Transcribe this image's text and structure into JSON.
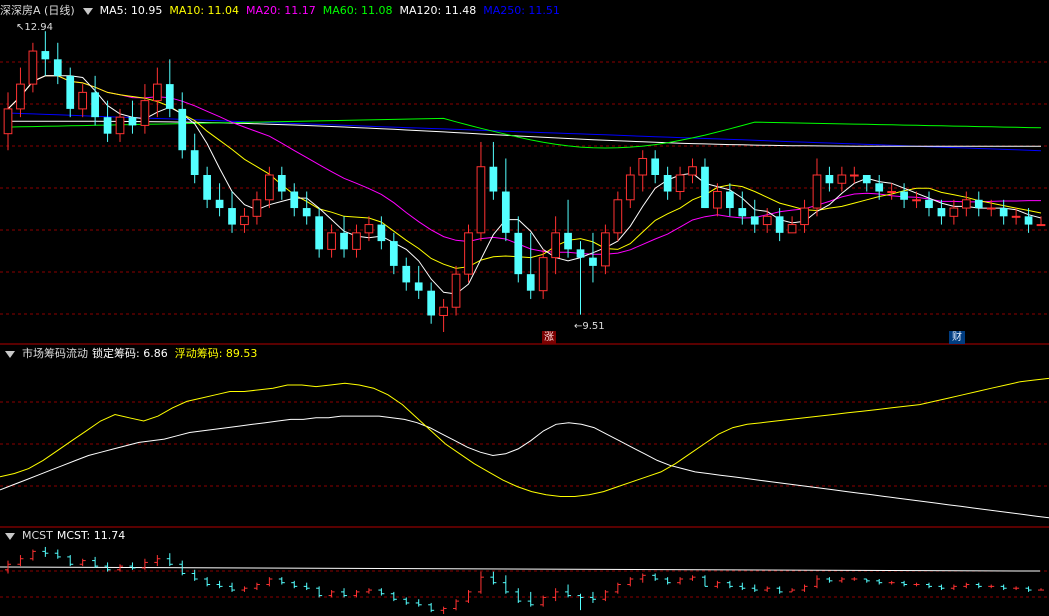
{
  "main_panel": {
    "title": "深深房A (日线)",
    "indicators": [
      {
        "label": "MA5: 10.95",
        "color": "#ffffff"
      },
      {
        "label": "MA10: 11.04",
        "color": "#ffff00"
      },
      {
        "label": "MA20: 11.17",
        "color": "#ff00ff"
      },
      {
        "label": "MA60: 11.08",
        "color": "#00ff00"
      },
      {
        "label": "MA120: 11.48",
        "color": "#ffffff"
      },
      {
        "label": "MA250: 11.51",
        "color": "#0000ff"
      }
    ],
    "high_label": "12.94",
    "low_label": "9.51",
    "marker_zhang": "涨",
    "marker_cai": "财"
  },
  "chip_panel": {
    "title": "市场筹码流动",
    "locked": "锁定筹码: 6.86",
    "floating_prefix": "浮动筹码",
    "floating_value": ": 89.53"
  },
  "mcst_panel": {
    "title": "MCST",
    "value": "MCST: 11.74"
  },
  "colors": {
    "up": "#ff3232",
    "down": "#54ffff",
    "grid": "#8b0000",
    "divider": "#b40000"
  },
  "chart_data": {
    "type": "candlestick",
    "price_range": [
      9.51,
      12.94
    ],
    "ohlc": [
      [
        11.7,
        12.2,
        11.5,
        12.0
      ],
      [
        12.0,
        12.5,
        11.9,
        12.3
      ],
      [
        12.3,
        12.8,
        12.2,
        12.7
      ],
      [
        12.7,
        12.94,
        12.4,
        12.6
      ],
      [
        12.6,
        12.8,
        12.3,
        12.4
      ],
      [
        12.4,
        12.5,
        11.9,
        12.0
      ],
      [
        12.0,
        12.3,
        11.9,
        12.2
      ],
      [
        12.2,
        12.4,
        11.8,
        11.9
      ],
      [
        11.9,
        12.1,
        11.6,
        11.7
      ],
      [
        11.7,
        12.0,
        11.6,
        11.9
      ],
      [
        11.9,
        12.1,
        11.7,
        11.8
      ],
      [
        11.8,
        12.3,
        11.7,
        12.1
      ],
      [
        12.1,
        12.5,
        11.9,
        12.3
      ],
      [
        12.3,
        12.6,
        11.9,
        12.0
      ],
      [
        12.0,
        12.2,
        11.4,
        11.5
      ],
      [
        11.5,
        11.7,
        11.1,
        11.2
      ],
      [
        11.2,
        11.3,
        10.8,
        10.9
      ],
      [
        10.9,
        11.1,
        10.7,
        10.8
      ],
      [
        10.8,
        11.0,
        10.5,
        10.6
      ],
      [
        10.6,
        10.8,
        10.5,
        10.7
      ],
      [
        10.7,
        11.0,
        10.6,
        10.9
      ],
      [
        10.9,
        11.3,
        10.8,
        11.2
      ],
      [
        11.2,
        11.3,
        10.9,
        11.0
      ],
      [
        11.0,
        11.1,
        10.7,
        10.8
      ],
      [
        10.8,
        11.0,
        10.6,
        10.7
      ],
      [
        10.7,
        10.8,
        10.2,
        10.3
      ],
      [
        10.3,
        10.6,
        10.2,
        10.5
      ],
      [
        10.5,
        10.7,
        10.2,
        10.3
      ],
      [
        10.3,
        10.6,
        10.2,
        10.5
      ],
      [
        10.5,
        10.7,
        10.4,
        10.6
      ],
      [
        10.6,
        10.7,
        10.3,
        10.4
      ],
      [
        10.4,
        10.5,
        10.0,
        10.1
      ],
      [
        10.1,
        10.2,
        9.8,
        9.9
      ],
      [
        9.9,
        10.1,
        9.7,
        9.8
      ],
      [
        9.8,
        9.9,
        9.4,
        9.5
      ],
      [
        9.5,
        9.7,
        9.3,
        9.6
      ],
      [
        9.6,
        10.1,
        9.5,
        10.0
      ],
      [
        10.0,
        10.6,
        9.9,
        10.5
      ],
      [
        10.5,
        11.6,
        10.4,
        11.3
      ],
      [
        11.3,
        11.6,
        10.9,
        11.0
      ],
      [
        11.0,
        11.4,
        10.4,
        10.5
      ],
      [
        10.5,
        10.7,
        9.9,
        10.0
      ],
      [
        10.0,
        10.5,
        9.7,
        9.8
      ],
      [
        9.8,
        10.3,
        9.7,
        10.2
      ],
      [
        10.2,
        10.7,
        10.0,
        10.5
      ],
      [
        10.5,
        10.9,
        10.2,
        10.3
      ],
      [
        10.3,
        10.4,
        9.51,
        10.2
      ],
      [
        10.2,
        10.5,
        9.9,
        10.1
      ],
      [
        10.1,
        10.6,
        10.0,
        10.5
      ],
      [
        10.5,
        11.0,
        10.4,
        10.9
      ],
      [
        10.9,
        11.3,
        10.8,
        11.2
      ],
      [
        11.2,
        11.5,
        11.0,
        11.4
      ],
      [
        11.4,
        11.5,
        11.1,
        11.2
      ],
      [
        11.2,
        11.3,
        10.9,
        11.0
      ],
      [
        11.0,
        11.3,
        10.9,
        11.2
      ],
      [
        11.2,
        11.4,
        11.1,
        11.3
      ],
      [
        11.3,
        11.4,
        10.8,
        10.8
      ],
      [
        10.8,
        11.1,
        10.7,
        11.0
      ],
      [
        11.0,
        11.1,
        10.7,
        10.8
      ],
      [
        10.8,
        11.0,
        10.6,
        10.7
      ],
      [
        10.7,
        10.9,
        10.5,
        10.6
      ],
      [
        10.6,
        10.8,
        10.5,
        10.7
      ],
      [
        10.7,
        10.8,
        10.4,
        10.5
      ],
      [
        10.5,
        10.7,
        10.5,
        10.6
      ],
      [
        10.6,
        10.9,
        10.5,
        10.8
      ],
      [
        10.8,
        11.4,
        10.7,
        11.2
      ],
      [
        11.2,
        11.3,
        11.0,
        11.1
      ],
      [
        11.1,
        11.3,
        11.0,
        11.2
      ],
      [
        11.2,
        11.3,
        11.1,
        11.2
      ],
      [
        11.2,
        11.2,
        11.0,
        11.1
      ],
      [
        11.1,
        11.2,
        10.9,
        11.0
      ],
      [
        11.0,
        11.1,
        10.9,
        11.0
      ],
      [
        11.0,
        11.1,
        10.8,
        10.9
      ],
      [
        10.9,
        11.0,
        10.8,
        10.9
      ],
      [
        10.9,
        11.0,
        10.7,
        10.8
      ],
      [
        10.8,
        10.9,
        10.6,
        10.7
      ],
      [
        10.7,
        10.9,
        10.6,
        10.8
      ],
      [
        10.8,
        11.0,
        10.7,
        10.9
      ],
      [
        10.9,
        11.0,
        10.7,
        10.8
      ],
      [
        10.8,
        10.9,
        10.7,
        10.8
      ],
      [
        10.8,
        10.9,
        10.6,
        10.7
      ],
      [
        10.7,
        10.8,
        10.6,
        10.7
      ],
      [
        10.7,
        10.8,
        10.5,
        10.6
      ],
      [
        10.6,
        10.7,
        10.6,
        10.6
      ]
    ],
    "chip_locked": [
      0.22,
      0.25,
      0.28,
      0.31,
      0.34,
      0.37,
      0.4,
      0.43,
      0.45,
      0.47,
      0.49,
      0.51,
      0.52,
      0.53,
      0.55,
      0.57,
      0.58,
      0.59,
      0.6,
      0.61,
      0.62,
      0.63,
      0.64,
      0.65,
      0.65,
      0.66,
      0.66,
      0.67,
      0.67,
      0.67,
      0.67,
      0.66,
      0.65,
      0.63,
      0.6,
      0.56,
      0.52,
      0.48,
      0.45,
      0.43,
      0.44,
      0.47,
      0.52,
      0.58,
      0.62,
      0.63,
      0.62,
      0.6,
      0.56,
      0.52,
      0.48,
      0.44,
      0.4,
      0.37,
      0.35,
      0.33,
      0.32,
      0.31,
      0.3,
      0.29,
      0.28,
      0.27,
      0.26,
      0.25,
      0.24,
      0.23,
      0.22,
      0.21,
      0.2,
      0.19,
      0.18,
      0.17,
      0.16,
      0.15,
      0.14,
      0.13,
      0.12,
      0.11,
      0.1,
      0.09,
      0.08,
      0.07,
      0.06,
      0.05
    ],
    "chip_floating": [
      0.3,
      0.32,
      0.35,
      0.4,
      0.46,
      0.52,
      0.58,
      0.64,
      0.68,
      0.66,
      0.64,
      0.67,
      0.72,
      0.76,
      0.78,
      0.8,
      0.82,
      0.82,
      0.83,
      0.84,
      0.86,
      0.86,
      0.85,
      0.86,
      0.87,
      0.86,
      0.84,
      0.8,
      0.74,
      0.66,
      0.58,
      0.5,
      0.44,
      0.38,
      0.33,
      0.28,
      0.24,
      0.21,
      0.19,
      0.18,
      0.18,
      0.19,
      0.21,
      0.24,
      0.27,
      0.3,
      0.33,
      0.38,
      0.44,
      0.5,
      0.56,
      0.6,
      0.62,
      0.63,
      0.64,
      0.65,
      0.66,
      0.67,
      0.68,
      0.69,
      0.7,
      0.71,
      0.72,
      0.73,
      0.74,
      0.76,
      0.78,
      0.8,
      0.82,
      0.84,
      0.86,
      0.88,
      0.89,
      0.9
    ]
  }
}
